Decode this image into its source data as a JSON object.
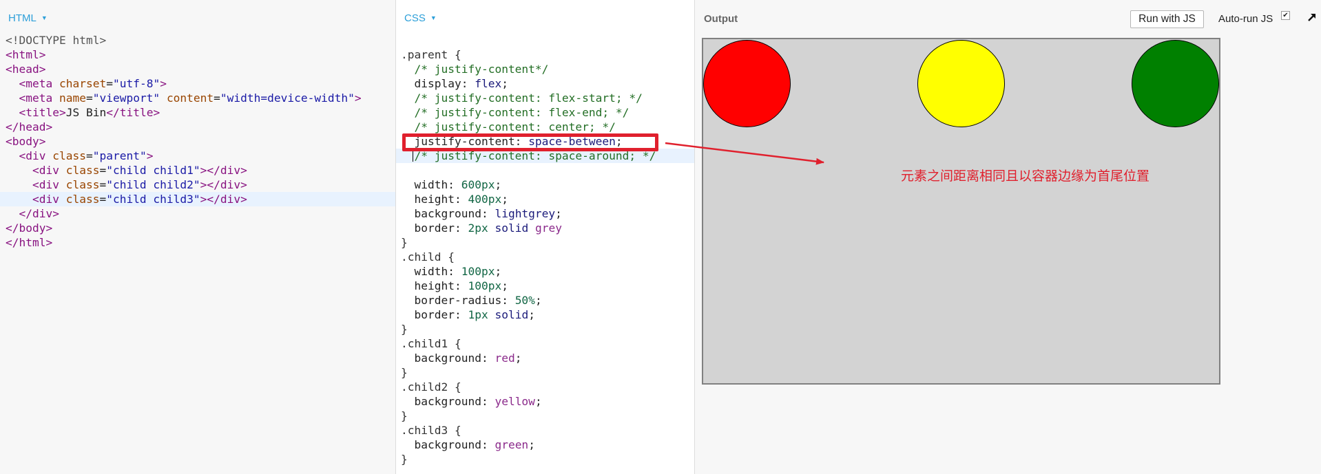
{
  "html_panel": {
    "label": "HTML",
    "lines": [
      [
        {
          "c": "t-doc",
          "t": "<!DOCTYPE html>"
        }
      ],
      [
        {
          "c": "t-tag",
          "t": "<html>"
        }
      ],
      [
        {
          "c": "t-tag",
          "t": "<head>"
        }
      ],
      [
        {
          "c": "t-text",
          "t": "  "
        },
        {
          "c": "t-tag",
          "t": "<meta "
        },
        {
          "c": "t-attr",
          "t": "charset"
        },
        {
          "c": "t-text",
          "t": "="
        },
        {
          "c": "t-str",
          "t": "\"utf-8\""
        },
        {
          "c": "t-tag",
          "t": ">"
        }
      ],
      [
        {
          "c": "t-text",
          "t": "  "
        },
        {
          "c": "t-tag",
          "t": "<meta "
        },
        {
          "c": "t-attr",
          "t": "name"
        },
        {
          "c": "t-text",
          "t": "="
        },
        {
          "c": "t-str",
          "t": "\"viewport\""
        },
        {
          "c": "t-text",
          "t": " "
        },
        {
          "c": "t-attr",
          "t": "content"
        },
        {
          "c": "t-text",
          "t": "="
        },
        {
          "c": "t-str",
          "t": "\"width=device-width\""
        },
        {
          "c": "t-tag",
          "t": ">"
        }
      ],
      [
        {
          "c": "t-text",
          "t": "  "
        },
        {
          "c": "t-tag",
          "t": "<title>"
        },
        {
          "c": "t-text",
          "t": "JS Bin"
        },
        {
          "c": "t-tag",
          "t": "</title>"
        }
      ],
      [
        {
          "c": "t-tag",
          "t": "</head>"
        }
      ],
      [
        {
          "c": "t-tag",
          "t": "<body>"
        }
      ],
      [
        {
          "c": "t-text",
          "t": "  "
        },
        {
          "c": "t-tag",
          "t": "<div "
        },
        {
          "c": "t-attr",
          "t": "class"
        },
        {
          "c": "t-text",
          "t": "="
        },
        {
          "c": "t-str",
          "t": "\"parent\""
        },
        {
          "c": "t-tag",
          "t": ">"
        }
      ],
      [
        {
          "c": "t-text",
          "t": "    "
        },
        {
          "c": "t-tag",
          "t": "<div "
        },
        {
          "c": "t-attr",
          "t": "class"
        },
        {
          "c": "t-text",
          "t": "="
        },
        {
          "c": "t-str",
          "t": "\"child child1\""
        },
        {
          "c": "t-tag",
          "t": "></div>"
        }
      ],
      [
        {
          "c": "t-text",
          "t": "    "
        },
        {
          "c": "t-tag",
          "t": "<div "
        },
        {
          "c": "t-attr",
          "t": "class"
        },
        {
          "c": "t-text",
          "t": "="
        },
        {
          "c": "t-str",
          "t": "\"child child2\""
        },
        {
          "c": "t-tag",
          "t": "></div>"
        }
      ],
      [
        {
          "c": "t-text",
          "t": "    "
        },
        {
          "c": "t-tag",
          "t": "<div "
        },
        {
          "c": "t-attr",
          "t": "class"
        },
        {
          "c": "t-text",
          "t": "="
        },
        {
          "c": "t-str",
          "t": "\"child child3\""
        },
        {
          "c": "t-tag",
          "t": "></div>"
        }
      ],
      [
        {
          "c": "t-text",
          "t": "  "
        },
        {
          "c": "t-tag",
          "t": "</div>"
        }
      ],
      [
        {
          "c": "t-tag",
          "t": "</body>"
        }
      ],
      [
        {
          "c": "t-tag",
          "t": "</html>"
        }
      ]
    ],
    "active_line": 11
  },
  "css_panel": {
    "label": "CSS",
    "lines": [
      [
        {
          "c": "t-sel",
          "t": ".parent {"
        }
      ],
      [
        {
          "c": "t-text",
          "t": "  "
        },
        {
          "c": "t-comment",
          "t": "/* justify-content*/"
        }
      ],
      [
        {
          "c": "t-text",
          "t": "  "
        },
        {
          "c": "t-prop",
          "t": "display: "
        },
        {
          "c": "t-kw",
          "t": "flex"
        },
        {
          "c": "t-text",
          "t": ";"
        }
      ],
      [
        {
          "c": "t-text",
          "t": "  "
        },
        {
          "c": "t-comment",
          "t": "/* justify-content: flex-start; */"
        }
      ],
      [
        {
          "c": "t-text",
          "t": "  "
        },
        {
          "c": "t-comment",
          "t": "/* justify-content: flex-end; */"
        }
      ],
      [
        {
          "c": "t-text",
          "t": "  "
        },
        {
          "c": "t-comment",
          "t": "/* justify-content: center; */"
        }
      ],
      [
        {
          "c": "t-text",
          "t": "  "
        },
        {
          "c": "t-prop",
          "t": "justify-content: "
        },
        {
          "c": "t-kw",
          "t": "space-between"
        },
        {
          "c": "t-text",
          "t": ";"
        }
      ],
      [
        {
          "c": "t-text",
          "t": "  "
        },
        {
          "c": "t-comment",
          "t": "/* justify-content: space-around; */"
        }
      ],
      [
        {
          "c": "t-text",
          "t": ""
        }
      ],
      [
        {
          "c": "t-text",
          "t": "  "
        },
        {
          "c": "t-prop",
          "t": "width: "
        },
        {
          "c": "t-num",
          "t": "600px"
        },
        {
          "c": "t-text",
          "t": ";"
        }
      ],
      [
        {
          "c": "t-text",
          "t": "  "
        },
        {
          "c": "t-prop",
          "t": "height: "
        },
        {
          "c": "t-num",
          "t": "400px"
        },
        {
          "c": "t-text",
          "t": ";"
        }
      ],
      [
        {
          "c": "t-text",
          "t": "  "
        },
        {
          "c": "t-prop",
          "t": "background: "
        },
        {
          "c": "t-kw",
          "t": "lightgrey"
        },
        {
          "c": "t-text",
          "t": ";"
        }
      ],
      [
        {
          "c": "t-text",
          "t": "  "
        },
        {
          "c": "t-prop",
          "t": "border: "
        },
        {
          "c": "t-num",
          "t": "2px"
        },
        {
          "c": "t-text",
          "t": " "
        },
        {
          "c": "t-kw",
          "t": "solid"
        },
        {
          "c": "t-text",
          "t": " "
        },
        {
          "c": "t-color",
          "t": "grey"
        }
      ],
      [
        {
          "c": "t-sel",
          "t": "}"
        }
      ],
      [
        {
          "c": "t-sel",
          "t": ".child {"
        }
      ],
      [
        {
          "c": "t-text",
          "t": "  "
        },
        {
          "c": "t-prop",
          "t": "width: "
        },
        {
          "c": "t-num",
          "t": "100px"
        },
        {
          "c": "t-text",
          "t": ";"
        }
      ],
      [
        {
          "c": "t-text",
          "t": "  "
        },
        {
          "c": "t-prop",
          "t": "height: "
        },
        {
          "c": "t-num",
          "t": "100px"
        },
        {
          "c": "t-text",
          "t": ";"
        }
      ],
      [
        {
          "c": "t-text",
          "t": "  "
        },
        {
          "c": "t-prop",
          "t": "border-radius: "
        },
        {
          "c": "t-num",
          "t": "50%"
        },
        {
          "c": "t-text",
          "t": ";"
        }
      ],
      [
        {
          "c": "t-text",
          "t": "  "
        },
        {
          "c": "t-prop",
          "t": "border: "
        },
        {
          "c": "t-num",
          "t": "1px"
        },
        {
          "c": "t-text",
          "t": " "
        },
        {
          "c": "t-kw",
          "t": "solid"
        },
        {
          "c": "t-text",
          "t": ";"
        }
      ],
      [
        {
          "c": "t-sel",
          "t": "}"
        }
      ],
      [
        {
          "c": "t-sel",
          "t": ".child1 {"
        }
      ],
      [
        {
          "c": "t-text",
          "t": "  "
        },
        {
          "c": "t-prop",
          "t": "background: "
        },
        {
          "c": "t-color",
          "t": "red"
        },
        {
          "c": "t-text",
          "t": ";"
        }
      ],
      [
        {
          "c": "t-sel",
          "t": "}"
        }
      ],
      [
        {
          "c": "t-sel",
          "t": ".child2 {"
        }
      ],
      [
        {
          "c": "t-text",
          "t": "  "
        },
        {
          "c": "t-prop",
          "t": "background: "
        },
        {
          "c": "t-color",
          "t": "yellow"
        },
        {
          "c": "t-text",
          "t": ";"
        }
      ],
      [
        {
          "c": "t-sel",
          "t": "}"
        }
      ],
      [
        {
          "c": "t-sel",
          "t": ".child3 {"
        }
      ],
      [
        {
          "c": "t-text",
          "t": "  "
        },
        {
          "c": "t-prop",
          "t": "background: "
        },
        {
          "c": "t-color",
          "t": "green"
        },
        {
          "c": "t-text",
          "t": ";"
        }
      ],
      [
        {
          "c": "t-sel",
          "t": "}"
        }
      ]
    ],
    "active_line": 7
  },
  "output": {
    "label": "Output",
    "run_button": "Run with JS",
    "autorun_label": "Auto-run JS",
    "autorun_checked": true,
    "preview": {
      "background": "#d3d3d3",
      "border_color": "#808080",
      "children": [
        {
          "name": "child1",
          "color": "#ff0000"
        },
        {
          "name": "child2",
          "color": "#ffff00"
        },
        {
          "name": "child3",
          "color": "#008000"
        }
      ]
    }
  },
  "annotation": {
    "text": "元素之间距离相同且以容器边缘为首尾位置",
    "color": "#e0202d"
  }
}
